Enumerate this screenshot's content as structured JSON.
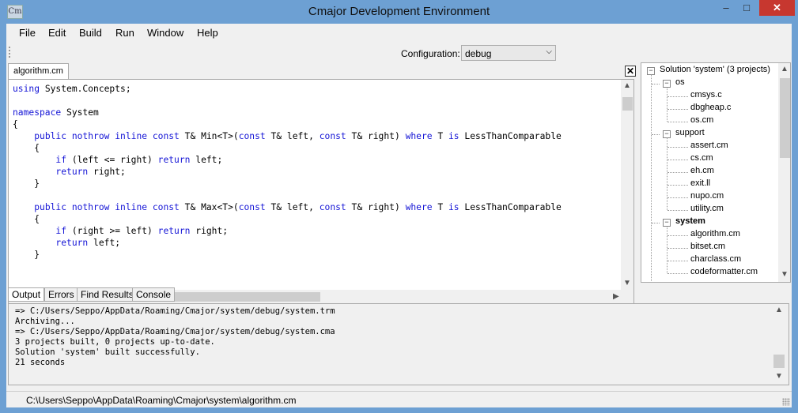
{
  "window": {
    "title": "Cmajor Development Environment",
    "icon_text": "Cm",
    "minimize": "–",
    "maximize": "□",
    "close": "✕"
  },
  "menu": {
    "file": "File",
    "edit": "Edit",
    "build": "Build",
    "run": "Run",
    "window": "Window",
    "help": "Help"
  },
  "toolbar": {
    "configuration_label": "Configuration:",
    "configuration_value": "debug",
    "dropdown_arrow": "⌵"
  },
  "editor": {
    "tab_label": "algorithm.cm",
    "close_label": "✕",
    "lines": [
      [
        [
          "kw",
          "using"
        ],
        [
          "t",
          " System.Concepts;"
        ]
      ],
      [
        [
          "t",
          ""
        ]
      ],
      [
        [
          "kw",
          "namespace"
        ],
        [
          "t",
          " System"
        ]
      ],
      [
        [
          "t",
          "{"
        ]
      ],
      [
        [
          "t",
          "    "
        ],
        [
          "kw",
          "public nothrow inline const"
        ],
        [
          "t",
          " T& Min<T>("
        ],
        [
          "kw",
          "const"
        ],
        [
          "t",
          " T& left, "
        ],
        [
          "kw",
          "const"
        ],
        [
          "t",
          " T& right) "
        ],
        [
          "kw",
          "where"
        ],
        [
          "t",
          " T "
        ],
        [
          "kw",
          "is"
        ],
        [
          "t",
          " LessThanComparable"
        ]
      ],
      [
        [
          "t",
          "    {"
        ]
      ],
      [
        [
          "t",
          "        "
        ],
        [
          "kw",
          "if"
        ],
        [
          "t",
          " (left <= right) "
        ],
        [
          "kw",
          "return"
        ],
        [
          "t",
          " left;"
        ]
      ],
      [
        [
          "t",
          "        "
        ],
        [
          "kw",
          "return"
        ],
        [
          "t",
          " right;"
        ]
      ],
      [
        [
          "t",
          "    }"
        ]
      ],
      [
        [
          "t",
          ""
        ]
      ],
      [
        [
          "t",
          "    "
        ],
        [
          "kw",
          "public nothrow inline const"
        ],
        [
          "t",
          " T& Max<T>("
        ],
        [
          "kw",
          "const"
        ],
        [
          "t",
          " T& left, "
        ],
        [
          "kw",
          "const"
        ],
        [
          "t",
          " T& right) "
        ],
        [
          "kw",
          "where"
        ],
        [
          "t",
          " T "
        ],
        [
          "kw",
          "is"
        ],
        [
          "t",
          " LessThanComparable"
        ]
      ],
      [
        [
          "t",
          "    {"
        ]
      ],
      [
        [
          "t",
          "        "
        ],
        [
          "kw",
          "if"
        ],
        [
          "t",
          " (right >= left) "
        ],
        [
          "kw",
          "return"
        ],
        [
          "t",
          " right;"
        ]
      ],
      [
        [
          "t",
          "        "
        ],
        [
          "kw",
          "return"
        ],
        [
          "t",
          " left;"
        ]
      ],
      [
        [
          "t",
          "    }"
        ]
      ]
    ],
    "colors": {
      "keyword": "#1515d6",
      "text": "#000000"
    }
  },
  "solution": {
    "root": "Solution 'system' (3 projects)",
    "projects": [
      {
        "name": "os",
        "bold": false,
        "files": [
          "cmsys.c",
          "dbgheap.c",
          "os.cm"
        ]
      },
      {
        "name": "support",
        "bold": false,
        "files": [
          "assert.cm",
          "cs.cm",
          "eh.cm",
          "exit.ll",
          "nupo.cm",
          "utility.cm"
        ]
      },
      {
        "name": "system",
        "bold": true,
        "files": [
          "algorithm.cm",
          "bitset.cm",
          "charclass.cm",
          "codeformatter.cm"
        ]
      }
    ],
    "expanded_glyph": "−"
  },
  "output": {
    "tabs": [
      "Output",
      "Errors",
      "Find Results",
      "Console"
    ],
    "lines": [
      "=> C:/Users/Seppo/AppData/Roaming/Cmajor/system/debug/system.trm",
      "Archiving...",
      "=> C:/Users/Seppo/AppData/Roaming/Cmajor/system/debug/system.cma",
      "3 projects built, 0 projects up-to-date.",
      "Solution 'system' built successfully.",
      "21 seconds"
    ]
  },
  "status": {
    "path": "C:\\Users\\Seppo\\AppData\\Roaming\\Cmajor\\system\\algorithm.cm"
  },
  "scroll": {
    "up": "▲",
    "down": "▼",
    "left": "◀",
    "right": "▶"
  }
}
